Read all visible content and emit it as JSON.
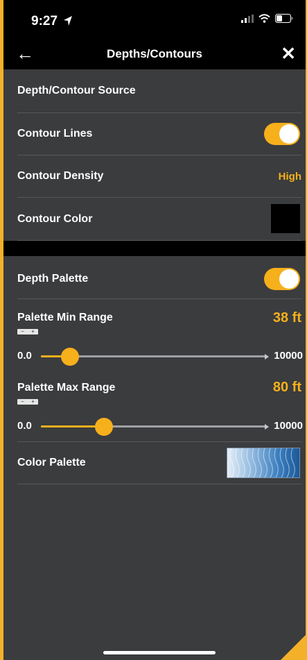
{
  "status": {
    "time": "9:27"
  },
  "nav": {
    "back_icon": "←",
    "title": "Depths/Contours",
    "close_icon": "✕"
  },
  "settings": [
    {
      "label": "Depth/Contour Source"
    },
    {
      "label": "Contour Lines",
      "toggle": "on"
    },
    {
      "label": "Contour Density",
      "value": "High"
    },
    {
      "label": "Contour Color",
      "swatch_color": "#000000"
    }
  ],
  "palette_section": {
    "depth_palette": {
      "label": "Depth Palette",
      "toggle": "on"
    },
    "min_range": {
      "label": "Palette Min Range",
      "value": "38 ft",
      "stepper": {
        "minus": "−",
        "plus": "+"
      },
      "slider": {
        "min_label": "0.0",
        "max_label": "10000",
        "position": 0.13
      }
    },
    "max_range": {
      "label": "Palette Max Range",
      "value": "80 ft",
      "stepper": {
        "minus": "−",
        "plus": "+"
      },
      "slider": {
        "min_label": "0.0",
        "max_label": "10000",
        "position": 0.28
      }
    },
    "color_palette": {
      "label": "Color Palette"
    }
  },
  "colors": {
    "accent": "#f6b01b",
    "background": "#3b3c3e",
    "header": "#000000",
    "divider": "#56585b"
  }
}
